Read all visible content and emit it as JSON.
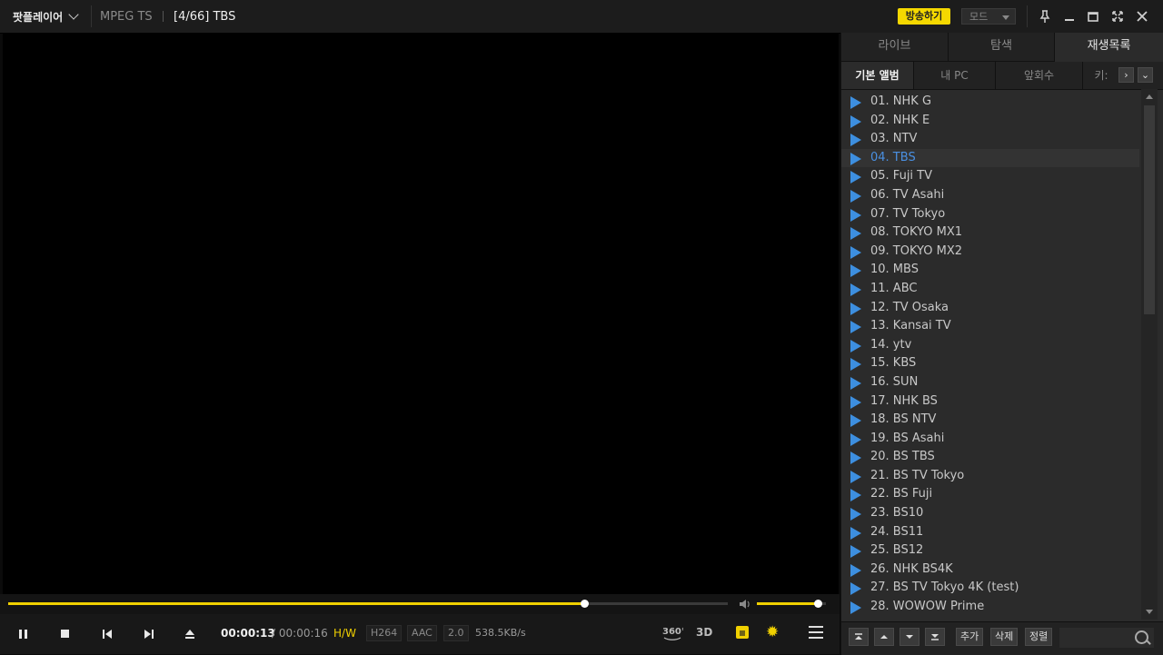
{
  "titlebar": {
    "app_name": "팟플레이어",
    "format": "MPEG TS",
    "now_playing": "[4/66] TBS",
    "broadcast_label": "방송하기",
    "mode_label": "모드"
  },
  "playback": {
    "current_time": "00:00:13",
    "separator": "/",
    "total_time": "00:00:16",
    "hw_label": "H/W",
    "video_codec": "H264",
    "audio_codec": "AAC",
    "channels": "2.0",
    "bitrate": "538.5KB/s",
    "progress": 0.8,
    "volume": 0.88
  },
  "panel": {
    "tabs": [
      "라이브",
      "탐색",
      "재생목록"
    ],
    "subtabs": [
      "기본 앨범",
      "내 PC",
      "앞회수",
      "키:"
    ],
    "current_index": 3,
    "items": [
      "01. NHK G",
      "02. NHK E",
      "03. NTV",
      "04. TBS",
      "05. Fuji TV",
      "06. TV Asahi",
      "07. TV Tokyo",
      "08. TOKYO MX1",
      "09. TOKYO MX2",
      "10. MBS",
      "11. ABC",
      "12. TV Osaka",
      "13. Kansai TV",
      "14. ytv",
      "15. KBS",
      "16. SUN",
      "17. NHK BS",
      "18. BS NTV",
      "19. BS Asahi",
      "20. BS TBS",
      "21. BS TV Tokyo",
      "22. BS Fuji",
      "23. BS10",
      "24. BS11",
      "25. BS12",
      "26. NHK BS4K",
      "27. BS TV Tokyo 4K (test)",
      "28. WOWOW Prime"
    ],
    "footer_buttons": [
      "추가",
      "삭제",
      "정렬"
    ]
  },
  "colors": {
    "accent": "#f0d000",
    "link": "#4a90e2",
    "play_icon": "#3d8fe0"
  }
}
